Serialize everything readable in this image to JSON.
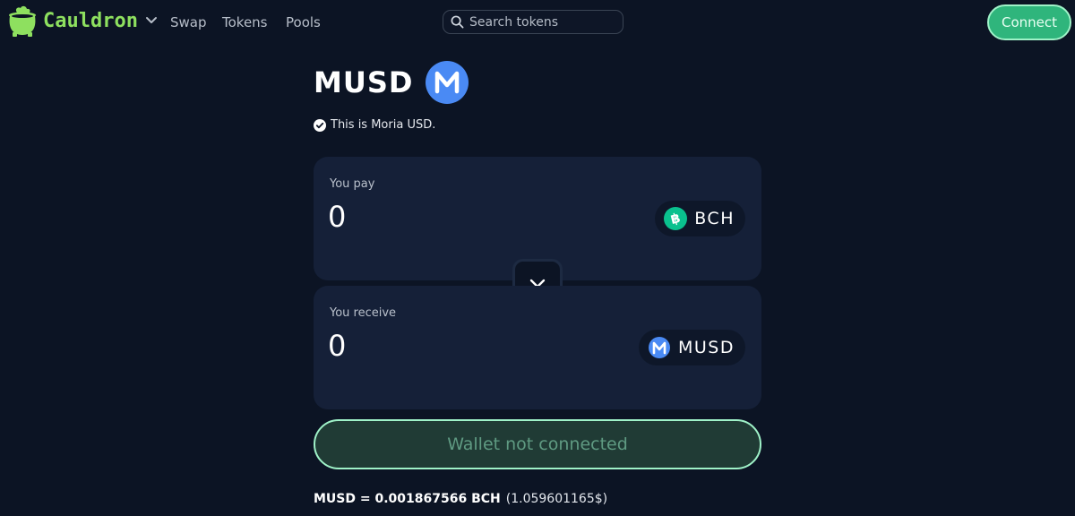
{
  "header": {
    "brand": "Cauldron",
    "nav": [
      "Swap",
      "Tokens",
      "Pools"
    ],
    "search_placeholder": "Search tokens",
    "connect_label": "Connect"
  },
  "token": {
    "title": "MUSD",
    "description": "This is Moria USD."
  },
  "swap": {
    "pay_label": "You pay",
    "pay_amount": "0",
    "pay_token": "BCH",
    "receive_label": "You receive",
    "receive_amount": "0",
    "receive_token": "MUSD",
    "action_label": "Wallet not connected"
  },
  "rate": {
    "text": "MUSD = 0.001867566 BCH",
    "usd": "(1.059601165$)"
  },
  "colors": {
    "background": "#0c1424",
    "card": "#152038",
    "brand_green": "#8ee05f",
    "connect_green": "#2fb57c",
    "bch_green": "#0ac18e",
    "musd_blue": "#4a8af4"
  },
  "icons": {
    "brand": "cauldron-icon",
    "search": "search-icon",
    "verified": "check-circle-icon",
    "toggle": "chevron-down-icon",
    "bch": "bch-icon",
    "musd": "musd-icon"
  }
}
